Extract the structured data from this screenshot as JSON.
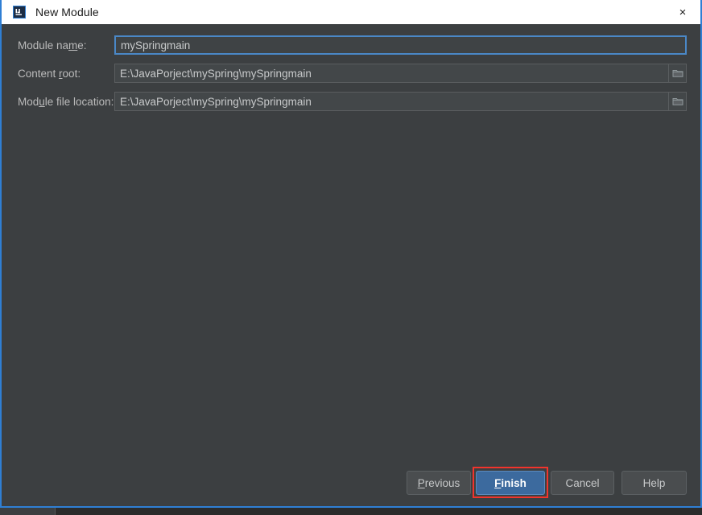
{
  "window": {
    "title": "New Module",
    "app_icon": "intellij-idea-icon",
    "close_label": "×",
    "accent_border_color": "#2f7fd4",
    "titlebar_background": "#ffffff",
    "body_background": "#3c3f41"
  },
  "form": {
    "rows": [
      {
        "label_prefix": "Module na",
        "label_mnemonic": "m",
        "label_suffix": "e:",
        "value": "mySpringmain",
        "focused": true,
        "has_browse": false,
        "browse_icon": "folder-icon"
      },
      {
        "label_prefix": "Content ",
        "label_mnemonic": "r",
        "label_suffix": "oot:",
        "value": "E:\\JavaPorject\\mySpring\\mySpringmain",
        "focused": false,
        "has_browse": true,
        "browse_icon": "folder-icon"
      },
      {
        "label_prefix": "Mod",
        "label_mnemonic": "u",
        "label_suffix": "le file location:",
        "value": "E:\\JavaPorject\\mySpring\\mySpringmain",
        "focused": false,
        "has_browse": true,
        "browse_icon": "folder-icon"
      }
    ]
  },
  "buttons": {
    "previous": {
      "prefix": "",
      "mnemonic": "P",
      "suffix": "revious"
    },
    "finish": {
      "prefix": "",
      "mnemonic": "F",
      "suffix": "inish"
    },
    "cancel": {
      "label": "Cancel"
    },
    "help": {
      "label": "Help"
    }
  },
  "annotation": {
    "target": "finish-button",
    "color": "#f2342c"
  }
}
